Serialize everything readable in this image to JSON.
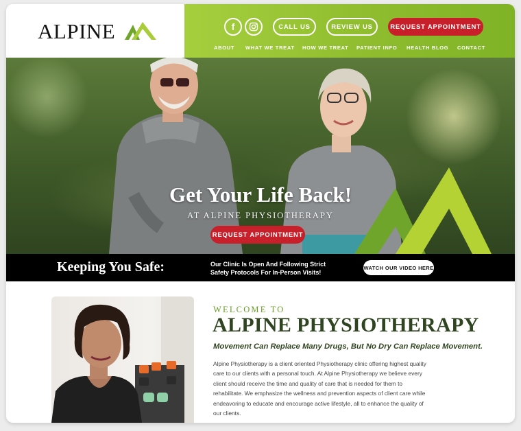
{
  "header": {
    "logo_text": "ALPINE",
    "social": [
      {
        "icon": "facebook-icon",
        "glyph": "f"
      },
      {
        "icon": "instagram-icon"
      }
    ],
    "buttons": {
      "call": "CALL US",
      "review": "REVIEW US",
      "request": "REQUEST APPOINTMENT"
    },
    "nav": [
      "ABOUT",
      "WHAT WE TREAT",
      "HOW WE TREAT",
      "PATIENT INFO",
      "HEALTH BLOG",
      "CONTACT"
    ]
  },
  "hero": {
    "title": "Get Your Life Back!",
    "subtitle": "AT ALPINE PHYSIOTHERAPY",
    "button": "REQUEST APPOINTMENT"
  },
  "safety": {
    "title": "Keeping You Safe:",
    "text_line1": "Our Clinic Is Open And Following Strict",
    "text_line2": "Safety Protocols For In-Person Visits!",
    "button": "WATCH OUR VIDEO HERE"
  },
  "welcome": {
    "kicker": "WELCOME TO",
    "title": "ALPINE PHYSIOTHERAPY",
    "tagline": "Movement Can Replace Many Drugs, But No Dry Can Replace Movement.",
    "lines": [
      "Alpine Physiotherapy is a client oriented Physiotherapy clinic offering highest quality",
      "care to our clients with a personal touch. At Alpine Physiotherapy we believe every",
      "client should receive the time and quality of care that is needed for them to",
      "rehabilitate. We emphasize the wellness and prevention aspects of client care while",
      "endeavoring to educate and encourage active lifestyle, all to enhance the quality of",
      "our clients."
    ]
  },
  "colors": {
    "brand_green": "#8fbd2f",
    "accent_red": "#c8202a",
    "dark_green": "#2f4420"
  }
}
